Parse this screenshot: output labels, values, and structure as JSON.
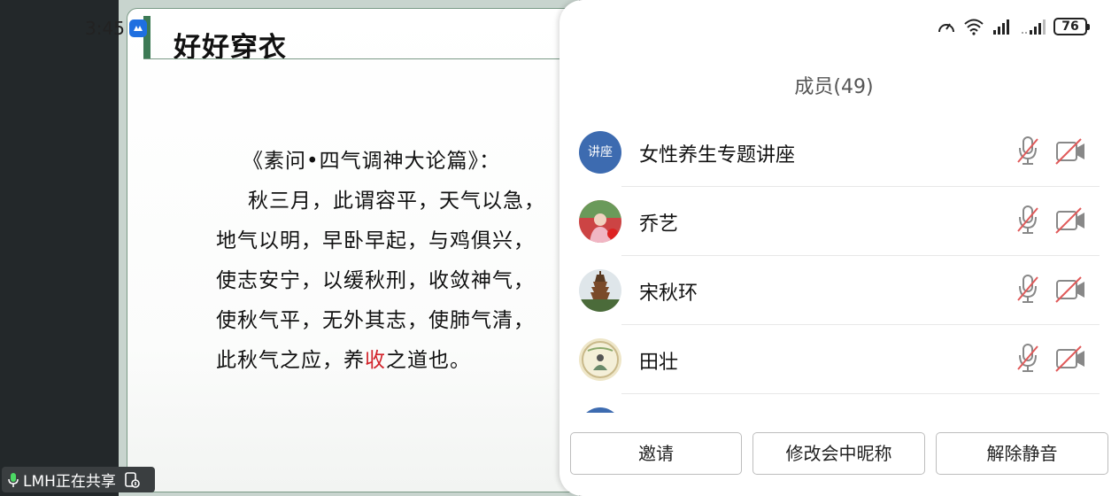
{
  "status_bar": {
    "time": "3:45",
    "battery": "76"
  },
  "slide": {
    "title": "好好穿衣",
    "poem_title": "《素问•四气调神大论篇》：",
    "lines": [
      "秋三月，此谓容平，天气以急，",
      "地气以明，早卧早起，与鸡俱兴，",
      "使志安宁，以缓秋刑，收敛神气，",
      "使秋气平，无外其志，使肺气清，"
    ],
    "last_line_before": "此秋气之应，养",
    "last_line_highlight": "收",
    "last_line_after": "之道也。",
    "highlight_color": "#d2232a"
  },
  "share_indicator": {
    "label": "LMH正在共享"
  },
  "panel": {
    "title": "成员(49)",
    "members": [
      {
        "name": "女性养生专题讲座",
        "avatar_text": "讲座",
        "mic": "mic-muted-icon",
        "camera": "camera-off-icon"
      },
      {
        "name": "乔艺",
        "avatar": "photo",
        "mic": "mic-muted-icon",
        "camera": "camera-off-icon"
      },
      {
        "name": "宋秋环",
        "avatar": "pagoda-photo",
        "mic": "mic-muted-icon",
        "camera": "camera-off-icon"
      },
      {
        "name": "田壮",
        "avatar": "painting-photo",
        "mic": "mic-muted-icon",
        "camera": "camera-off-icon"
      }
    ],
    "buttons": {
      "invite": "邀请",
      "rename": "修改会中昵称",
      "unmute": "解除静音"
    }
  },
  "colors": {
    "accent_green": "#3d7a55",
    "avatar_blue": "#3d6bb0",
    "muted_red": "#e05a5a"
  }
}
